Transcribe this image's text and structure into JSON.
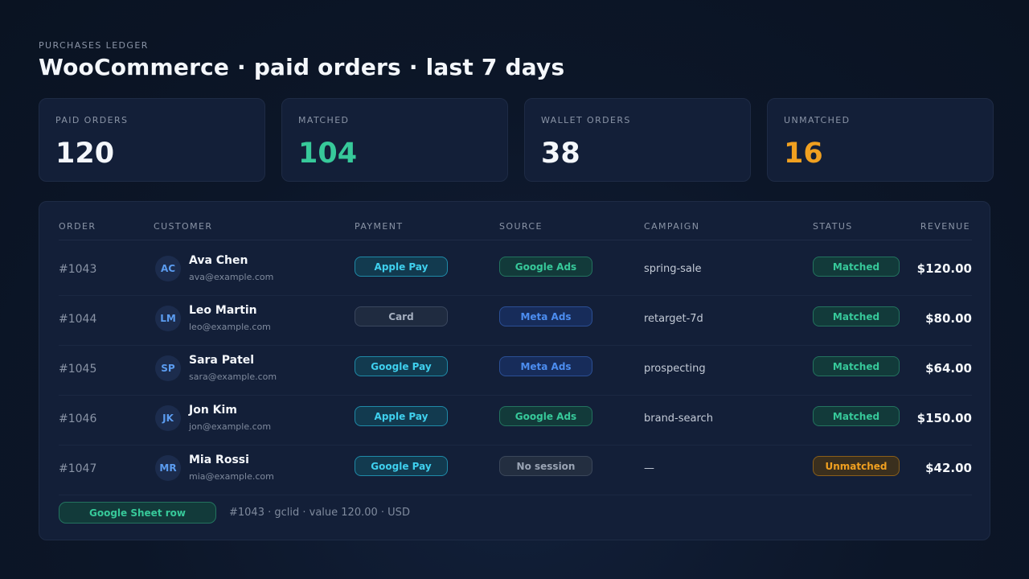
{
  "header": {
    "eyebrow": "PURCHASES LEDGER",
    "title": "WooCommerce · paid orders · last 7 days"
  },
  "stats": [
    {
      "label": "PAID ORDERS",
      "value": "120",
      "color": "#f4f7fb"
    },
    {
      "label": "MATCHED",
      "value": "104",
      "color": "#37c99a"
    },
    {
      "label": "WALLET ORDERS",
      "value": "38",
      "color": "#f4f7fb"
    },
    {
      "label": "UNMATCHED",
      "value": "16",
      "color": "#f0a020"
    }
  ],
  "table": {
    "columns": [
      "ORDER",
      "CUSTOMER",
      "PAYMENT",
      "SOURCE",
      "CAMPAIGN",
      "STATUS",
      "REVENUE"
    ],
    "rows": [
      {
        "order": "#1043",
        "initials": "AC",
        "name": "Ava Chen",
        "email": "ava@example.com",
        "payment": "Apple Pay",
        "source": "Google Ads",
        "campaign": "spring-sale",
        "status": "Matched",
        "revenue": "$120.00"
      },
      {
        "order": "#1044",
        "initials": "LM",
        "name": "Leo Martin",
        "email": "leo@example.com",
        "payment": "Card",
        "source": "Meta Ads",
        "campaign": "retarget-7d",
        "status": "Matched",
        "revenue": "$80.00"
      },
      {
        "order": "#1045",
        "initials": "SP",
        "name": "Sara Patel",
        "email": "sara@example.com",
        "payment": "Google Pay",
        "source": "Meta Ads",
        "campaign": "prospecting",
        "status": "Matched",
        "revenue": "$64.00"
      },
      {
        "order": "#1046",
        "initials": "JK",
        "name": "Jon Kim",
        "email": "jon@example.com",
        "payment": "Apple Pay",
        "source": "Google Ads",
        "campaign": "brand-search",
        "status": "Matched",
        "revenue": "$150.00"
      },
      {
        "order": "#1047",
        "initials": "MR",
        "name": "Mia Rossi",
        "email": "mia@example.com",
        "payment": "Google Pay",
        "source": "No session",
        "campaign": "—",
        "status": "Unmatched",
        "revenue": "$42.00"
      }
    ]
  },
  "footer": {
    "pill": "Google Sheet row",
    "note": "#1043 · gclid · value 120.00 · USD"
  },
  "colors": {
    "matched": "#37c99a",
    "unmatched": "#f0a020",
    "wallet_pay": "#3fd0ee",
    "meta": "#4c8df0"
  }
}
